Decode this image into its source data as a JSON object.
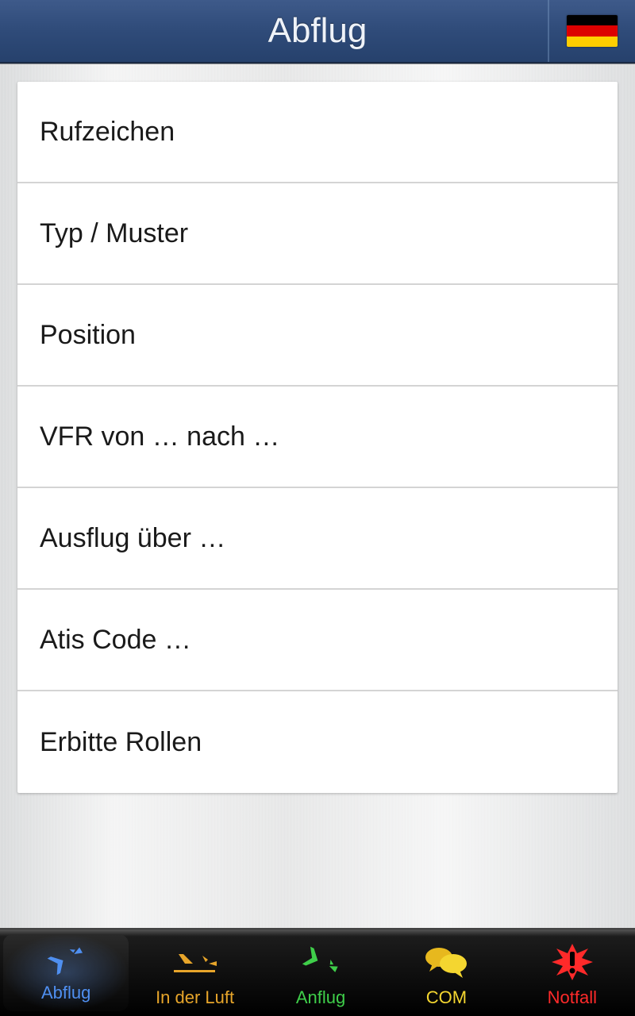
{
  "header": {
    "title": "Abflug",
    "flag": "german-flag"
  },
  "list": {
    "items": [
      {
        "label": "Rufzeichen"
      },
      {
        "label": "Typ / Muster"
      },
      {
        "label": "Position"
      },
      {
        "label": "VFR von … nach …"
      },
      {
        "label": "Ausflug über …"
      },
      {
        "label": "Atis Code …"
      },
      {
        "label": "Erbitte Rollen"
      }
    ]
  },
  "tabs": [
    {
      "label": "Abflug",
      "icon": "plane-takeoff-icon",
      "color": "blue",
      "selected": true
    },
    {
      "label": "In der Luft",
      "icon": "plane-cruise-icon",
      "color": "orange",
      "selected": false
    },
    {
      "label": "Anflug",
      "icon": "plane-landing-icon",
      "color": "green",
      "selected": false
    },
    {
      "label": "COM",
      "icon": "chat-bubbles-icon",
      "color": "yellow",
      "selected": false
    },
    {
      "label": "Notfall",
      "icon": "alert-burst-icon",
      "color": "red",
      "selected": false
    }
  ]
}
